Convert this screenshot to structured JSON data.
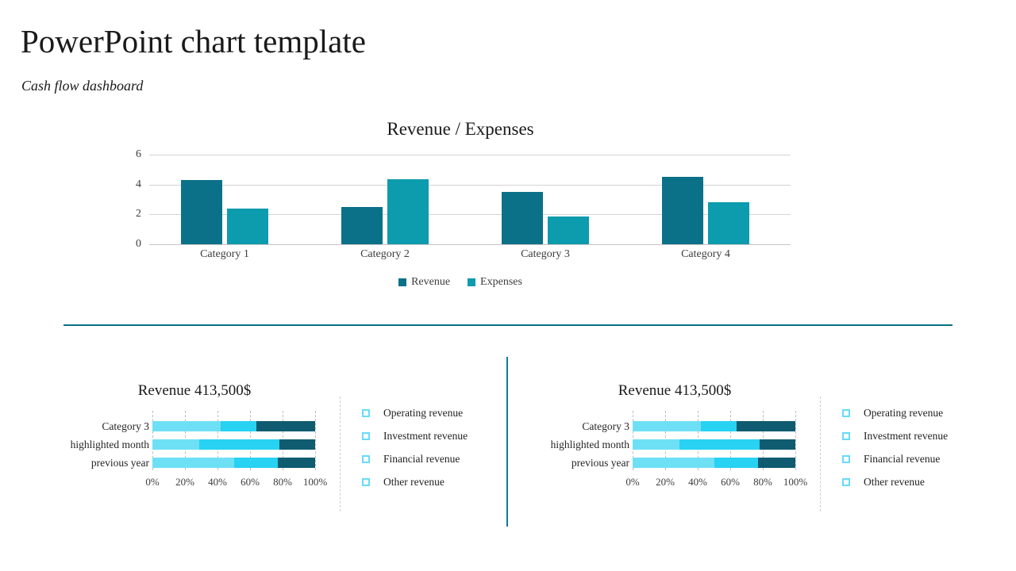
{
  "header": {
    "title": "PowerPoint chart template",
    "subtitle": "Cash flow dashboard"
  },
  "colors": {
    "revenue": "#0a7189",
    "expenses": "#0d9bae",
    "divider": "#0a6f84",
    "panel_divider": "#0d7a99",
    "seg_operating": "#6ee0f5",
    "seg_investment": "#27d2f2",
    "seg_financial": "#0f5b70",
    "seg_other": "#0f5b70",
    "legend_marker": "#66dcf7"
  },
  "chart_data": [
    {
      "type": "bar",
      "title": "Revenue / Expenses",
      "categories": [
        "Category 1",
        "Category 2",
        "Category 3",
        "Category 4"
      ],
      "series": [
        {
          "name": "Revenue",
          "values": [
            4.3,
            2.5,
            3.5,
            4.5
          ]
        },
        {
          "name": "Expenses",
          "values": [
            2.4,
            4.35,
            1.85,
            2.8
          ]
        }
      ],
      "yticks": [
        0,
        2,
        4,
        6
      ],
      "ylim": [
        0,
        6
      ],
      "xlabel": "",
      "ylabel": "",
      "grid": true,
      "legend_position": "bottom"
    },
    {
      "type": "bar",
      "subtype": "stacked-horizontal-100",
      "title": "Revenue 413,500$",
      "categories": [
        "Category 3",
        "highlighted month",
        "previous year"
      ],
      "series": [
        {
          "name": "Operating revenue",
          "values": [
            42,
            29,
            50
          ]
        },
        {
          "name": "Investment revenue",
          "values": [
            22,
            49,
            27
          ]
        },
        {
          "name": "Financial revenue",
          "values": [
            36,
            22,
            23
          ]
        },
        {
          "name": "Other revenue",
          "values": [
            0,
            0,
            0
          ]
        }
      ],
      "xticks": [
        "0%",
        "20%",
        "40%",
        "60%",
        "80%",
        "100%"
      ],
      "xlim": [
        0,
        100
      ],
      "grid": true,
      "legend_position": "right"
    },
    {
      "type": "bar",
      "subtype": "stacked-horizontal-100",
      "title": "Revenue 413,500$",
      "categories": [
        "Category 3",
        "highlighted month",
        "previous year"
      ],
      "series": [
        {
          "name": "Operating revenue",
          "values": [
            42,
            29,
            50
          ]
        },
        {
          "name": "Investment revenue",
          "values": [
            22,
            49,
            27
          ]
        },
        {
          "name": "Financial revenue",
          "values": [
            36,
            22,
            23
          ]
        },
        {
          "name": "Other revenue",
          "values": [
            0,
            0,
            0
          ]
        }
      ],
      "xticks": [
        "0%",
        "20%",
        "40%",
        "60%",
        "80%",
        "100%"
      ],
      "xlim": [
        0,
        100
      ],
      "grid": true,
      "legend_position": "right"
    }
  ]
}
